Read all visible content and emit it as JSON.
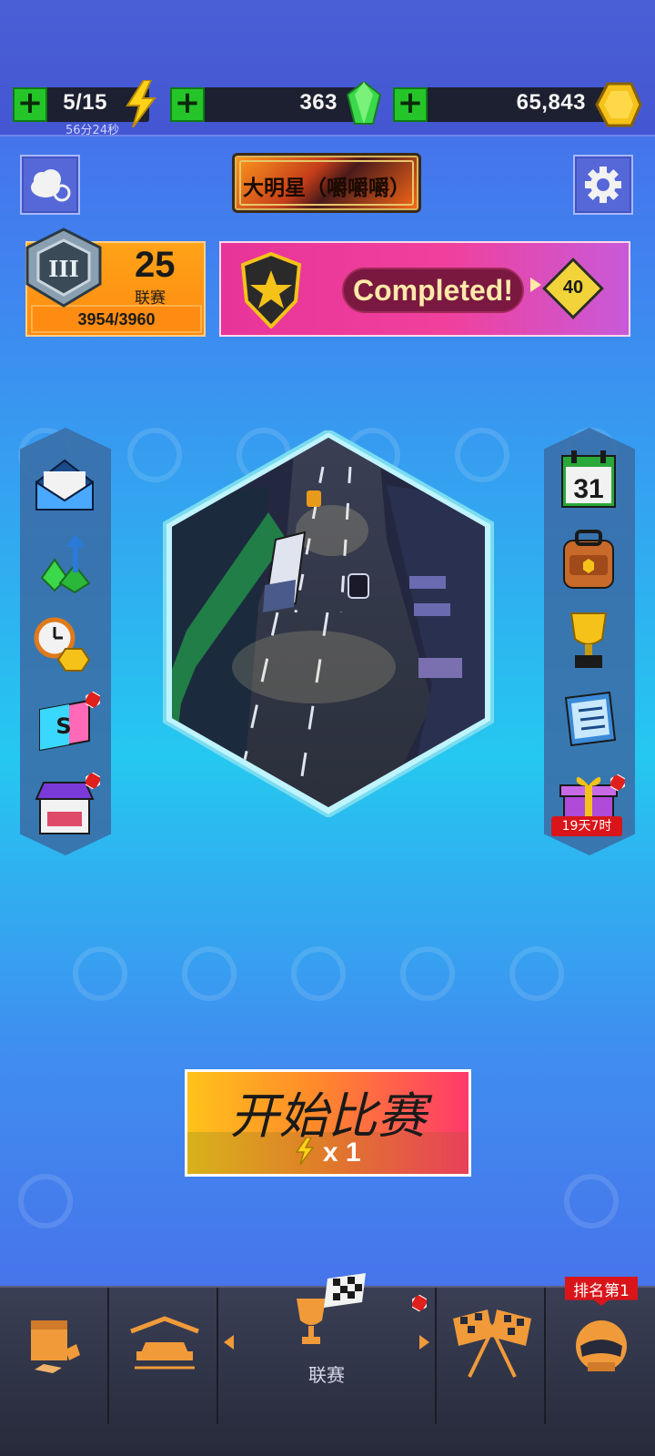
{
  "resources": {
    "energy": {
      "value": "5/15",
      "timer": "56分24秒"
    },
    "gems": {
      "value": "363"
    },
    "coins": {
      "value": "65,843"
    }
  },
  "header": {
    "title_plate": "大明星（嚼嚼嚼）"
  },
  "league": {
    "level": "25",
    "label": "联赛",
    "progress_text": "3954/3960",
    "progress_fraction": 0.998,
    "tier_roman": "III"
  },
  "banner": {
    "status": "Completed!",
    "reward": "40"
  },
  "right_panel": {
    "calendar_day": "31",
    "gift_timer": "19天7时"
  },
  "start_button": {
    "label": "开始比赛",
    "cost": "x 1"
  },
  "bottom_nav": {
    "active_label": "联赛",
    "rank_tag": "排名第1"
  },
  "colors": {
    "accent_orange": "#ff8a10",
    "banner_pink": "#f0409c",
    "plus_green": "#25c52a"
  }
}
